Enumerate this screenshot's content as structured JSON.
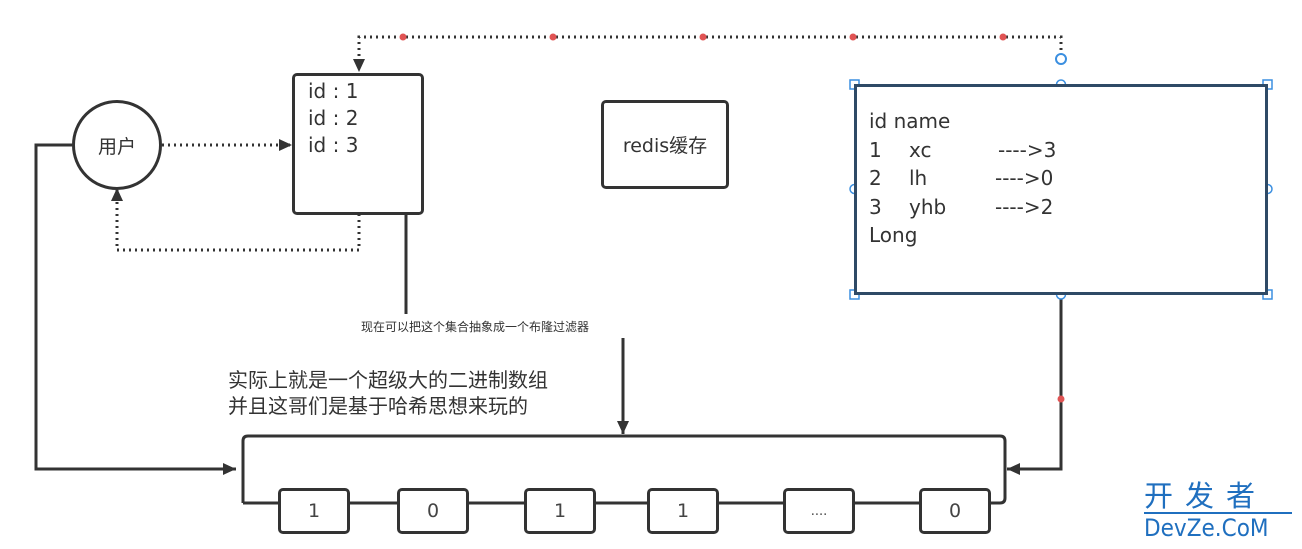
{
  "diagram": {
    "user_node": {
      "label": "用户"
    },
    "id_list_node": {
      "lines": [
        "id   :   1",
        "id   :   2",
        "id   :   3"
      ]
    },
    "redis_node": {
      "label": "redis缓存"
    },
    "table_node": {
      "header": "id   name",
      "rows": [
        {
          "id": "1",
          "name": "xc",
          "arrow": "---->3"
        },
        {
          "id": "2",
          "name": "lh",
          "arrow": "---->0"
        },
        {
          "id": "3",
          "name": "yhb",
          "arrow": "---->2"
        }
      ],
      "footer": "Long",
      "selected": true
    },
    "connector_label": "现在可以把这个集合抽象成一个布隆过滤器",
    "description": {
      "line1": "实际上就是一个超级大的二进制数组",
      "line2": "并且这哥们是基于哈希思想来玩的"
    },
    "bit_array": {
      "cells": [
        "1",
        "0",
        "1",
        "1",
        "....",
        "0"
      ]
    },
    "colors": {
      "stroke": "#333333",
      "selection_border": "#2f4a66",
      "handle": "#3b8fe0",
      "waypoint": "#e05454",
      "watermark": "#1f6fbf"
    }
  },
  "watermark": {
    "cn": "开发者",
    "en": "DevZe.CoM"
  }
}
